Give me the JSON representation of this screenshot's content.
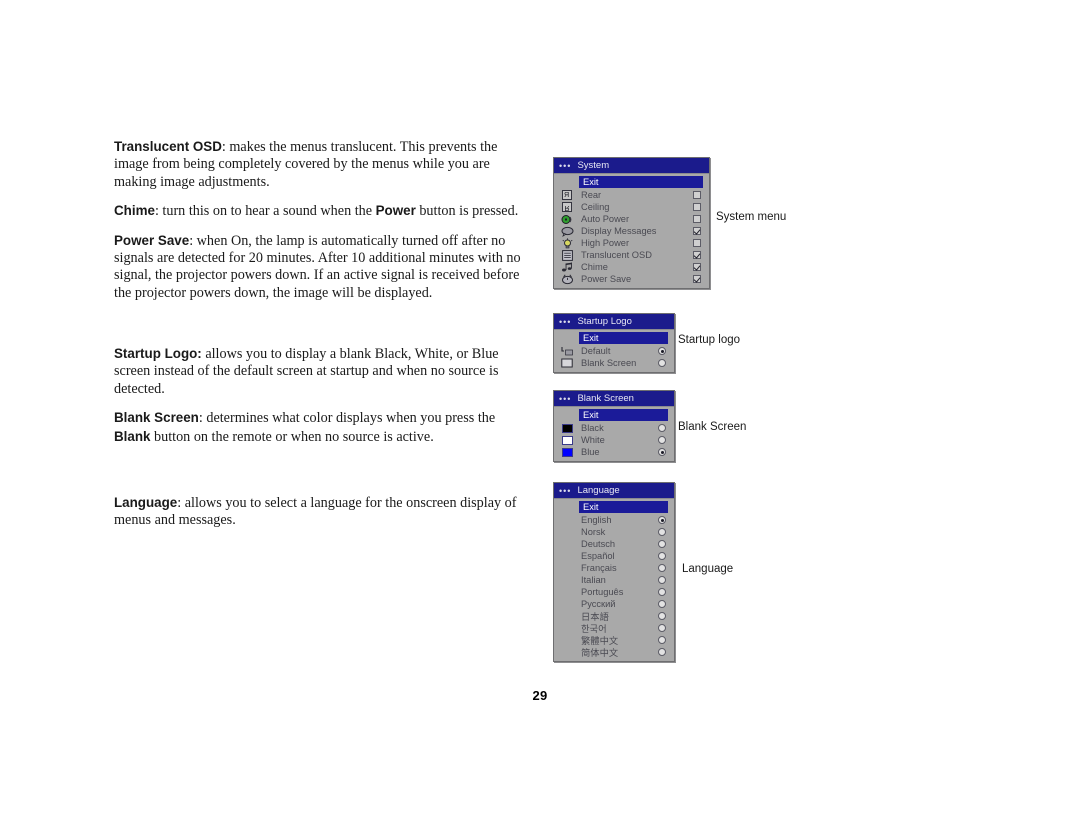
{
  "document": {
    "page_number": "29",
    "paragraphs": [
      {
        "id": "p1",
        "lead": "Translucent OSD",
        "body": ": makes the menus translucent. This prevents the image from being completely covered by the menus while you are making image adjustments."
      },
      {
        "id": "p2",
        "lead": "Chime",
        "body": ": turn this on to hear a sound when the ",
        "lead2": "Power",
        "body2": " button is pressed."
      },
      {
        "id": "p3",
        "lead": "Power Save",
        "body": ": when On, the lamp is automatically turned off after no signals are detected for 20 minutes. After 10 additional minutes with no signal, the projector powers down. If an active signal is received before the projector powers down, the image will be displayed."
      },
      {
        "id": "p4",
        "lead": "Startup Logo:",
        "body": " allows you to display a blank Black, White, or Blue screen instead of the default screen at startup and when no source is detected."
      },
      {
        "id": "p5",
        "lead": "Blank Screen",
        "body": ": determines what color displays when you press the ",
        "lead2": "Blank",
        "body2": " button on the remote or when no source is active."
      },
      {
        "id": "p6",
        "lead": "Language",
        "body": ": allows you to select a language for the onscreen display of menus and messages."
      }
    ]
  },
  "captions": {
    "system": "System menu",
    "startup": "Startup logo",
    "blank": "Blank Screen",
    "language": "Language"
  },
  "colors": {
    "title_bar": "#1b1b8c",
    "menu_body": "#a9a9a9",
    "highlight": "#1b1b99",
    "label_text": "#4a4a52",
    "swatch_black": "#000000",
    "swatch_white": "#ffffff",
    "swatch_blue": "#0000ff"
  },
  "system_menu": {
    "title": "System",
    "exit_label": "Exit",
    "items": [
      {
        "label": "Rear",
        "icon": "rear-projection-icon",
        "glyph": "R",
        "checked": false
      },
      {
        "label": "Ceiling",
        "icon": "ceiling-mount-icon",
        "glyph": "R",
        "checked": false
      },
      {
        "label": "Auto Power",
        "icon": "auto-power-icon",
        "glyph": "",
        "checked": false
      },
      {
        "label": "Display Messages",
        "icon": "speech-bubble-icon",
        "glyph": "",
        "checked": true
      },
      {
        "label": "High Power",
        "icon": "lightbulb-icon",
        "glyph": "",
        "checked": false
      },
      {
        "label": "Translucent OSD",
        "icon": "menu-panel-icon",
        "glyph": "",
        "checked": true
      },
      {
        "label": "Chime",
        "icon": "music-note-icon",
        "glyph": "",
        "checked": true
      },
      {
        "label": "Power Save",
        "icon": "power-save-clock-icon",
        "glyph": "",
        "checked": true
      }
    ]
  },
  "startup_logo_menu": {
    "title": "Startup Logo",
    "exit_label": "Exit",
    "items": [
      {
        "label": "Default",
        "icon": "default-logo-icon",
        "selected": true
      },
      {
        "label": "Blank Screen",
        "icon": "blank-screen-icon",
        "selected": false
      }
    ]
  },
  "blank_screen_menu": {
    "title": "Blank Screen",
    "exit_label": "Exit",
    "items": [
      {
        "label": "Black",
        "swatch": "#000000",
        "selected": false
      },
      {
        "label": "White",
        "swatch": "#ffffff",
        "selected": false
      },
      {
        "label": "Blue",
        "swatch": "#0000ff",
        "selected": true
      }
    ]
  },
  "language_menu": {
    "title": "Language",
    "exit_label": "Exit",
    "items": [
      {
        "label": "English",
        "selected": true
      },
      {
        "label": "Norsk",
        "selected": false
      },
      {
        "label": "Deutsch",
        "selected": false
      },
      {
        "label": "Español",
        "selected": false
      },
      {
        "label": "Français",
        "selected": false
      },
      {
        "label": "Italian",
        "selected": false
      },
      {
        "label": "Português",
        "selected": false
      },
      {
        "label": "Русский",
        "selected": false
      },
      {
        "label": "日本語",
        "selected": false
      },
      {
        "label": "한국어",
        "selected": false
      },
      {
        "label": "繁體中文",
        "selected": false
      },
      {
        "label": "简体中文",
        "selected": false
      }
    ]
  }
}
